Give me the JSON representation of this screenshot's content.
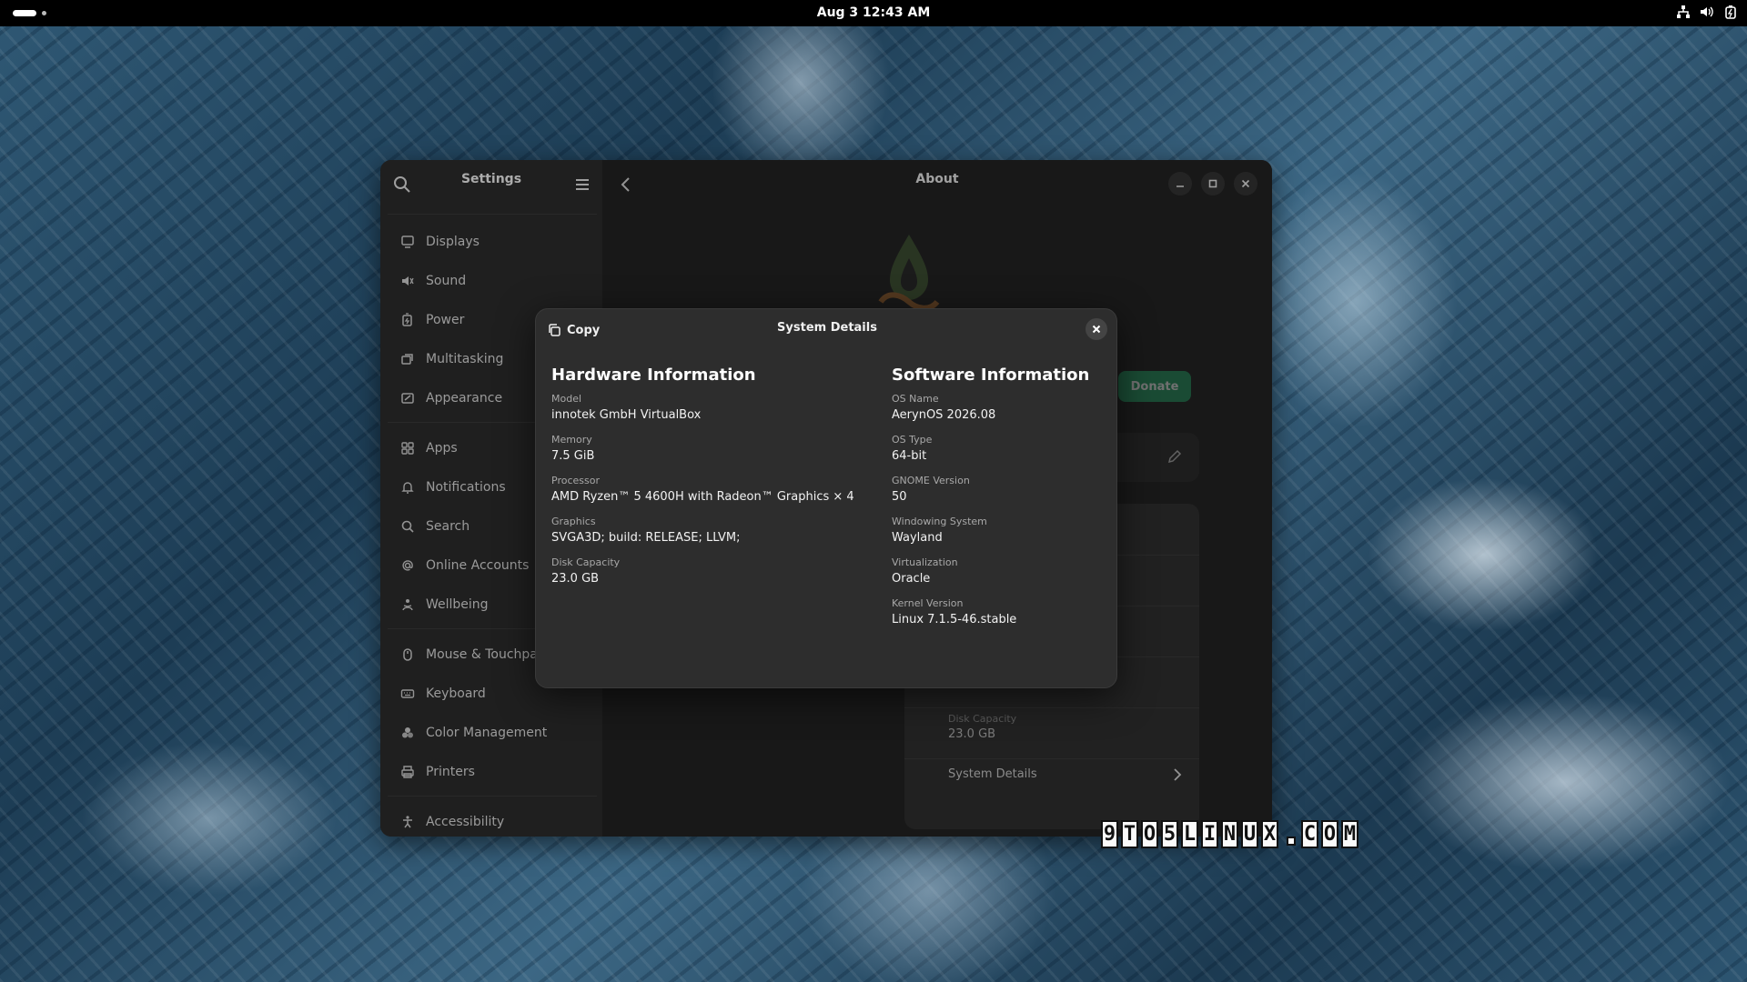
{
  "topbar": {
    "clock": "Aug 3  12:43 AM",
    "tray_icons": [
      "network-icon",
      "volume-icon",
      "battery-icon"
    ]
  },
  "window": {
    "sidebar_title": "Settings",
    "content_title": "About",
    "nav_groups": [
      [
        {
          "label": "Displays",
          "icon": "display-icon"
        },
        {
          "label": "Sound",
          "icon": "speaker-icon"
        },
        {
          "label": "Power",
          "icon": "power-icon"
        },
        {
          "label": "Multitasking",
          "icon": "multitasking-icon"
        },
        {
          "label": "Appearance",
          "icon": "appearance-icon"
        }
      ],
      [
        {
          "label": "Apps",
          "icon": "apps-grid-icon"
        },
        {
          "label": "Notifications",
          "icon": "bell-icon"
        },
        {
          "label": "Search",
          "icon": "search-icon"
        },
        {
          "label": "Online Accounts",
          "icon": "at-sign-icon"
        },
        {
          "label": "Wellbeing",
          "icon": "wellbeing-icon"
        }
      ],
      [
        {
          "label": "Mouse & Touchpad",
          "icon": "mouse-icon"
        },
        {
          "label": "Keyboard",
          "icon": "keyboard-icon"
        },
        {
          "label": "Color Management",
          "icon": "color-icon"
        },
        {
          "label": "Printers",
          "icon": "printer-icon"
        }
      ],
      [
        {
          "label": "Accessibility",
          "icon": "accessibility-icon"
        }
      ]
    ],
    "donate_label": "Donate",
    "background_disk_label": "Disk Capacity",
    "background_disk_value": "23.0 GB",
    "system_details_row": "System Details"
  },
  "dialog": {
    "copy_label": "Copy",
    "title": "System Details",
    "hardware": {
      "heading": "Hardware Information",
      "fields": [
        {
          "label": "Model",
          "value": "innotek GmbH VirtualBox"
        },
        {
          "label": "Memory",
          "value": "7.5 GiB"
        },
        {
          "label": "Processor",
          "value": "AMD Ryzen™ 5 4600H with Radeon™ Graphics × 4"
        },
        {
          "label": "Graphics",
          "value": "SVGA3D; build: RELEASE; LLVM;"
        },
        {
          "label": "Disk Capacity",
          "value": "23.0 GB"
        }
      ]
    },
    "software": {
      "heading": "Software Information",
      "fields": [
        {
          "label": "OS Name",
          "value": "AerynOS 2026.08"
        },
        {
          "label": "OS Type",
          "value": "64-bit"
        },
        {
          "label": "GNOME Version",
          "value": "50"
        },
        {
          "label": "Windowing System",
          "value": "Wayland"
        },
        {
          "label": "Virtualization",
          "value": "Oracle"
        },
        {
          "label": "Kernel Version",
          "value": "Linux 7.1.5-46.stable"
        }
      ]
    }
  },
  "watermark": "9TO5LINUX.COM",
  "colors": {
    "accent_green": "#26a269",
    "sidebar_bg": "#2b2b2b",
    "dialog_bg": "#2d2d2d"
  }
}
